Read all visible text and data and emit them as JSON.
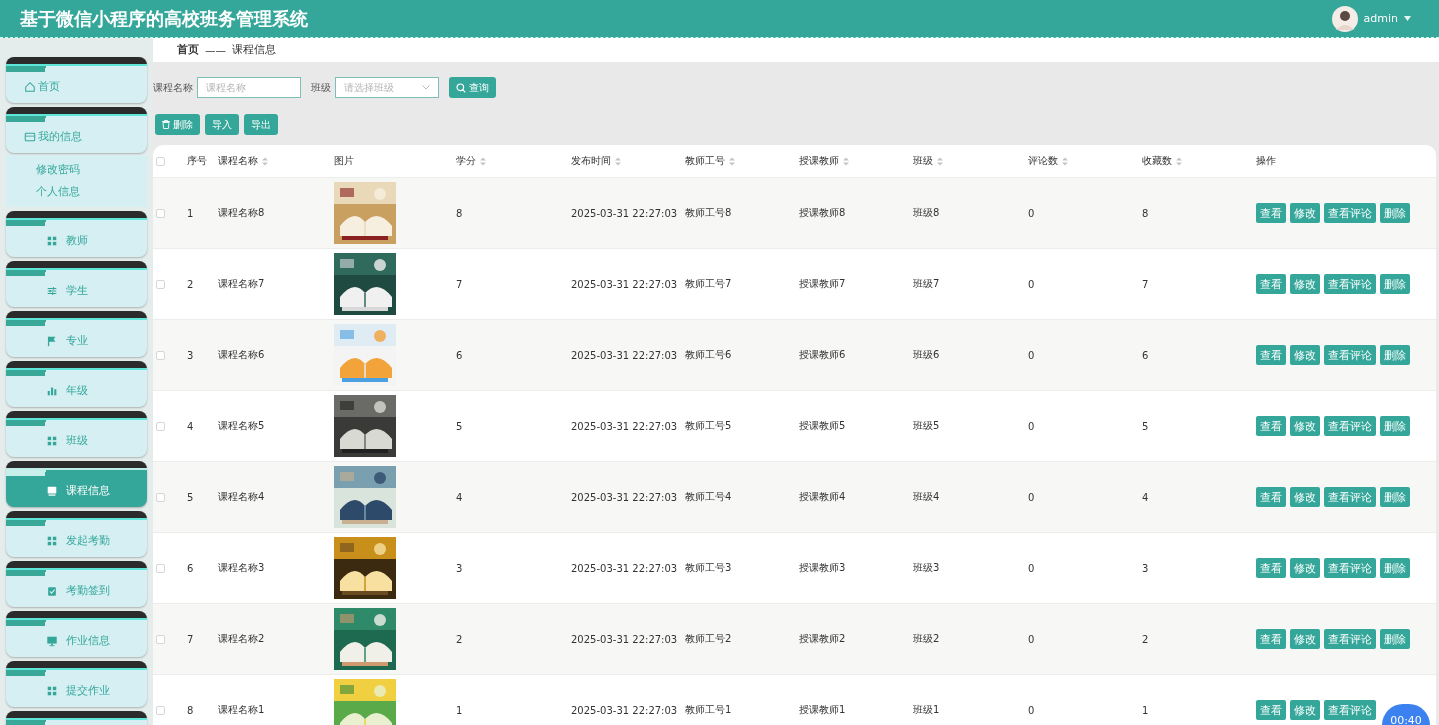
{
  "header": {
    "title": "基于微信小程序的高校班务管理系统",
    "user": "admin"
  },
  "sidebar": {
    "items": [
      {
        "label": "首页",
        "selected": false
      },
      {
        "label": "我的信息",
        "selected": false,
        "expanded": true,
        "children": [
          {
            "label": "修改密码"
          },
          {
            "label": "个人信息"
          }
        ]
      },
      {
        "label": "教师",
        "selected": false
      },
      {
        "label": "学生",
        "selected": false
      },
      {
        "label": "专业",
        "selected": false
      },
      {
        "label": "年级",
        "selected": false
      },
      {
        "label": "班级",
        "selected": false
      },
      {
        "label": "课程信息",
        "selected": true
      },
      {
        "label": "发起考勤",
        "selected": false
      },
      {
        "label": "考勤签到",
        "selected": false
      },
      {
        "label": "作业信息",
        "selected": false
      },
      {
        "label": "提交作业",
        "selected": false
      }
    ]
  },
  "breadcrumb": [
    "首页",
    "——",
    "课程信息"
  ],
  "search": {
    "fields": [
      {
        "label": "课程名称",
        "kind": "text",
        "placeholder": "课程名称"
      },
      {
        "label": "班级",
        "kind": "select",
        "placeholder": "请选择班级"
      }
    ],
    "button": "查询"
  },
  "actions": [
    {
      "label": "删除",
      "kind": "delete"
    },
    {
      "label": "导入",
      "kind": "plain"
    },
    {
      "label": "导出",
      "kind": "plain"
    }
  ],
  "table": {
    "select_all_checked": false,
    "columns": [
      {
        "label": "序号",
        "sortable": false
      },
      {
        "label": "课程名称",
        "sortable": true
      },
      {
        "label": "图片",
        "sortable": false
      },
      {
        "label": "学分",
        "sortable": true
      },
      {
        "label": "发布时间",
        "sortable": true
      },
      {
        "label": "教师工号",
        "sortable": true
      },
      {
        "label": "授课教师",
        "sortable": true
      },
      {
        "label": "班级",
        "sortable": true
      },
      {
        "label": "评论数",
        "sortable": true
      },
      {
        "label": "收藏数",
        "sortable": true
      },
      {
        "label": "操作",
        "sortable": false
      }
    ],
    "rows": [
      {
        "checked": false,
        "cells": [
          "1",
          "课程名称8",
          {
            "kind": "picture"
          },
          "8",
          "2025-03-31 22:27:03",
          "教师工号8",
          "授课教师8",
          "班级8",
          "0",
          "8"
        ],
        "buttons": [
          "查看",
          "修改",
          "查看评论",
          "删除"
        ]
      },
      {
        "checked": false,
        "cells": [
          "2",
          "课程名称7",
          {
            "kind": "picture"
          },
          "7",
          "2025-03-31 22:27:03",
          "教师工号7",
          "授课教师7",
          "班级7",
          "0",
          "7"
        ],
        "buttons": [
          "查看",
          "修改",
          "查看评论",
          "删除"
        ]
      },
      {
        "checked": false,
        "cells": [
          "3",
          "课程名称6",
          {
            "kind": "picture"
          },
          "6",
          "2025-03-31 22:27:03",
          "教师工号6",
          "授课教师6",
          "班级6",
          "0",
          "6"
        ],
        "buttons": [
          "查看",
          "修改",
          "查看评论",
          "删除"
        ]
      },
      {
        "checked": false,
        "cells": [
          "4",
          "课程名称5",
          {
            "kind": "picture"
          },
          "5",
          "2025-03-31 22:27:03",
          "教师工号5",
          "授课教师5",
          "班级5",
          "0",
          "5"
        ],
        "buttons": [
          "查看",
          "修改",
          "查看评论",
          "删除"
        ]
      },
      {
        "checked": false,
        "cells": [
          "5",
          "课程名称4",
          {
            "kind": "picture"
          },
          "4",
          "2025-03-31 22:27:03",
          "教师工号4",
          "授课教师4",
          "班级4",
          "0",
          "4"
        ],
        "buttons": [
          "查看",
          "修改",
          "查看评论",
          "删除"
        ]
      },
      {
        "checked": false,
        "cells": [
          "6",
          "课程名称3",
          {
            "kind": "picture"
          },
          "3",
          "2025-03-31 22:27:03",
          "教师工号3",
          "授课教师3",
          "班级3",
          "0",
          "3"
        ],
        "buttons": [
          "查看",
          "修改",
          "查看评论",
          "删除"
        ]
      },
      {
        "checked": false,
        "cells": [
          "7",
          "课程名称2",
          {
            "kind": "picture"
          },
          "2",
          "2025-03-31 22:27:03",
          "教师工号2",
          "授课教师2",
          "班级2",
          "0",
          "2"
        ],
        "buttons": [
          "查看",
          "修改",
          "查看评论",
          "删除"
        ]
      },
      {
        "checked": false,
        "cells": [
          "8",
          "课程名称1",
          {
            "kind": "picture"
          },
          "1",
          "2025-03-31 22:27:03",
          "教师工号1",
          "授课教师1",
          "班级1",
          "0",
          "1"
        ],
        "buttons": [
          "查看",
          "修改",
          "查看评论"
        ]
      }
    ]
  },
  "timer": "00:40"
}
